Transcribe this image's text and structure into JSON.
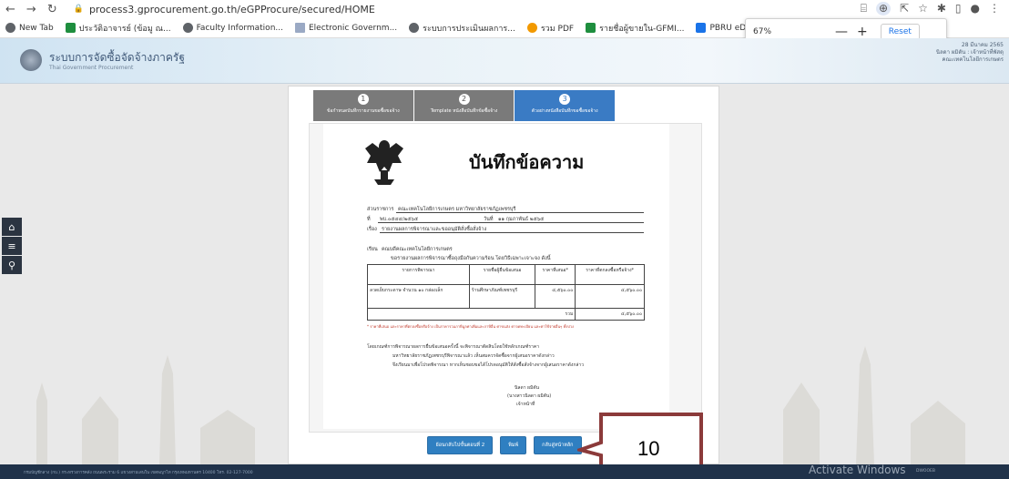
{
  "browser": {
    "url": "process3.gprocurement.go.th/eGPProcure/secured/HOME",
    "zoom_pct": "67%",
    "zoom_minus": "—",
    "zoom_plus": "+",
    "zoom_reset": "Reset",
    "bookmarks": [
      {
        "label": "New Tab",
        "icon": "globe"
      },
      {
        "label": "ประวัติอาจารย์ (ข้อมู ณ...",
        "icon": "green"
      },
      {
        "label": "Faculty Information...",
        "icon": "globe"
      },
      {
        "label": "Electronic Governm...",
        "icon": "flag"
      },
      {
        "label": "ระบบการประเมินผลการ...",
        "icon": "globe"
      },
      {
        "label": "รวม PDF",
        "icon": "orange"
      },
      {
        "label": "รายชื่อผู้ขายใน-GFMI...",
        "icon": "green"
      },
      {
        "label": "PBRU eDocument",
        "icon": "blue"
      }
    ]
  },
  "site": {
    "title": "ระบบการจัดซื้อจัดจ้างภาครัฐ",
    "subtitle": "Thai Government Procurement",
    "user_line1": "28 มีนาคม 2565",
    "user_line2": "นิลดา ผมิตัน : เจ้าหน้าที่พัสดุ",
    "user_line3": "คณะเทคโนโลยีการเกษตร"
  },
  "steps": [
    {
      "num": "1",
      "label": "ข้อกำหนดบันทึกรายงานขอซื้อขอจ้าง"
    },
    {
      "num": "2",
      "label": "Template หนังสือบันทึกข้อซื้อจ้าง"
    },
    {
      "num": "3",
      "label": "ตัวอย่างหนังสือบันทึกขอซื้อขอจ้าง"
    }
  ],
  "doc": {
    "title": "บันทึกข้อความ",
    "agency_label": "ส่วนราชการ",
    "agency_value": "คณะเทคโนโลยีการเกษตร มหาวิทยาลัยราชภัฏเพชรบุรี",
    "ref_label": "ที่",
    "ref_value": "พบ.๐๕๔๔/๒๕๖๕",
    "date_label": "วันที่",
    "date_value": "๑๑ กุมภาพันธ์ ๒๕๖๕",
    "subject_label": "เรื่อง",
    "subject_value": "รายงานผลการพิจารณาและขออนุมัติสั่งซื้อสั่งจ้าง",
    "to_label": "เรียน",
    "to_value": "คณบดีคณะเทคโนโลยีการเกษตร",
    "intro": "ขอรายงานผลการพิจารณาซื้อถุงมือกันความร้อน โดยวิธีเฉพาะเจาะจง ดังนี้",
    "table_headers": [
      "รายการพิจารณา",
      "รายชื่อผู้ยื่นข้อเสนอ",
      "ราคาที่เสนอ*",
      "ราคาที่ตกลงซื้อหรือจ้าง*"
    ],
    "table_rows": [
      [
        "ลวดเย็บกระดาษ จำนวน ๑๐ กล่องเล็ก",
        "ร้านศึกษาภัณฑ์เพชรบุรี",
        "๔,๕๖๐.๐๐",
        "๔,๕๖๐.๐๐"
      ]
    ],
    "total_label": "รวม",
    "total_value": "๔,๕๖๐.๐๐",
    "footnote": "* ราคาที่เสนอ และราคาที่ตกลงซื้อหรือจ้าง เป็นราคารวมภาษีมูลค่าเพิ่มและภาษีอื่น ค่าขนส่ง ค่าจดทะเบียน และค่าใช้จ่ายอื่นๆ ทั้งปวง",
    "para1": "โดยเกณฑ์การพิจารณาผลการยื่นข้อเสนอครั้งนี้ จะพิจารณาตัดสินโดยใช้หลักเกณฑ์ราคา",
    "para2": "มหาวิทยาลัยราชภัฏเพชรบุรีพิจารณาแล้ว เห็นสมควรจัดซื้อจากผู้เสนอราคาดังกล่าว",
    "para3": "จึงเรียนมาเพื่อโปรดพิจารณา หากเห็นชอบขอได้โปรดอนุมัติให้สั่งซื้อสั่งจ้างจากผู้เสนอราคาดังกล่าว",
    "sign_name": "นิลดา ผมิตัน",
    "sign_full": "(นางสาวนิลดา ผมิตัน)",
    "sign_role": "เจ้าหน้าที่"
  },
  "buttons": {
    "back_step": "ย้อนกลับไปขั้นตอนที่ 2",
    "print": "พิมพ์",
    "home": "กลับสู่หน้าหลัก"
  },
  "annotation": "10",
  "footer": {
    "text": "กรมบัญชีกลาง (กบ.) กระทรวงการคลัง ถนนพระราม 6 แขวงสามเสนใน เขตพญาไท กรุงเทพมหานคร 10400 โทร. 02-127-7000",
    "activate": "Activate Windows",
    "activate_sub": "DWOOEB"
  }
}
